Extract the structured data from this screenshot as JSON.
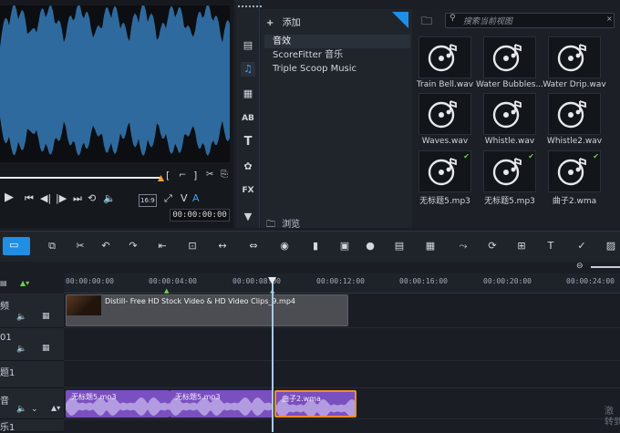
{
  "library": {
    "add_label": "添加",
    "categories": [
      "音效",
      "ScoreFitter 音乐",
      "Triple Scoop Music"
    ],
    "browse_label": "浏览",
    "search_placeholder": "搜索当前视图",
    "thumbs": [
      {
        "label": "Train Bell.wav",
        "checked": false
      },
      {
        "label": "Water Bubbles...",
        "checked": false
      },
      {
        "label": "Water Drip.wav",
        "checked": false
      },
      {
        "label": "Waves.wav",
        "checked": false
      },
      {
        "label": "Whistle.wav",
        "checked": false
      },
      {
        "label": "Whistle2.wav",
        "checked": false
      },
      {
        "label": "无标题5.mp3",
        "checked": true
      },
      {
        "label": "无标题5.mp3",
        "checked": true
      },
      {
        "label": "曲子2.wma",
        "checked": true
      }
    ]
  },
  "preview": {
    "timecode": "00:00:00:00",
    "quality": "16:9",
    "mark_labels": [
      "V",
      "A"
    ]
  },
  "timeline": {
    "ruler_labels": [
      "00:00:00:00",
      "00:00:04:00",
      "00:00:08:00",
      "00:00:12:00",
      "00:00:16:00",
      "00:00:20:00",
      "00:00:24:00"
    ],
    "tracks": [
      {
        "name": "频"
      },
      {
        "name": "01"
      },
      {
        "name": "题1"
      },
      {
        "name": "音"
      },
      {
        "name": "乐1"
      }
    ],
    "video_clip": "Distill- Free HD Stock Video & HD Video Clips_9.mp4",
    "audio_clips": [
      "无标题5.mp3",
      "无标题5.mp3",
      "曲子2.wma"
    ],
    "watermark": "激\n转到"
  },
  "colors": {
    "accent": "#1e8fe6",
    "waveform": "#2f6a9e",
    "audio_clip": "#7a4fbf",
    "check": "#6fd14a"
  }
}
